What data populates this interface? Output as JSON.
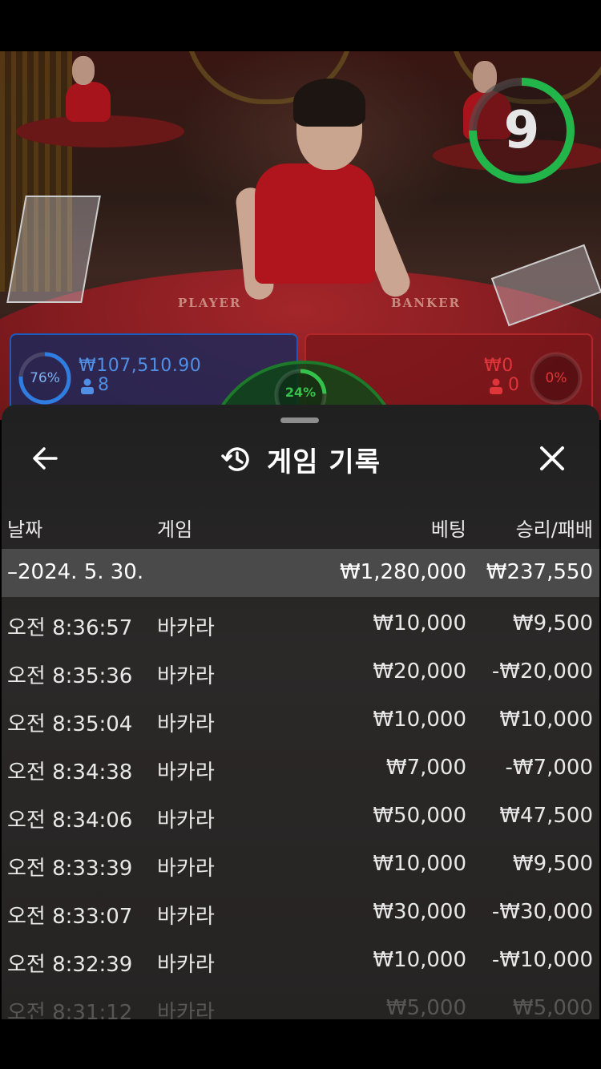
{
  "video": {
    "table_label_player": "PLAYER",
    "table_label_banker": "BANKER",
    "countdown": "9",
    "countdown_fraction": 0.75
  },
  "bets": {
    "player": {
      "percent": "76%",
      "percent_value": 0.76,
      "amount": "₩107,510.90",
      "count": "8",
      "color": "#1f59b8"
    },
    "banker": {
      "percent": "0%",
      "percent_value": 0.0,
      "amount": "₩0",
      "count": "0",
      "color": "#b2262a"
    },
    "tie": {
      "percent": "24%",
      "percent_value": 0.24,
      "color": "#35c24b"
    }
  },
  "history": {
    "title": "게임 기록",
    "columns": {
      "date": "날짜",
      "game": "게임",
      "bet": "베팅",
      "winloss": "승리/패배"
    },
    "day": {
      "date": "–2024. 5. 30.",
      "bet_total": "₩1,280,000",
      "winloss_total": "₩237,550"
    },
    "rows": [
      {
        "time": "오전 8:36:57",
        "game": "바카라",
        "bet": "₩10,000",
        "winloss": "₩9,500"
      },
      {
        "time": "오전 8:35:36",
        "game": "바카라",
        "bet": "₩20,000",
        "winloss": "-₩20,000"
      },
      {
        "time": "오전 8:35:04",
        "game": "바카라",
        "bet": "₩10,000",
        "winloss": "₩10,000"
      },
      {
        "time": "오전 8:34:38",
        "game": "바카라",
        "bet": "₩7,000",
        "winloss": "-₩7,000"
      },
      {
        "time": "오전 8:34:06",
        "game": "바카라",
        "bet": "₩50,000",
        "winloss": "₩47,500"
      },
      {
        "time": "오전 8:33:39",
        "game": "바카라",
        "bet": "₩10,000",
        "winloss": "₩9,500"
      },
      {
        "time": "오전 8:33:07",
        "game": "바카라",
        "bet": "₩30,000",
        "winloss": "-₩30,000"
      },
      {
        "time": "오전 8:32:39",
        "game": "바카라",
        "bet": "₩10,000",
        "winloss": "-₩10,000"
      },
      {
        "time": "오전 8:31:12",
        "game": "바카라",
        "bet": "₩5,000",
        "winloss": "₩5,000"
      }
    ]
  },
  "icons": {
    "back": "arrow-left-icon",
    "history": "history-clock-icon",
    "close": "close-icon",
    "player": "person-icon"
  }
}
